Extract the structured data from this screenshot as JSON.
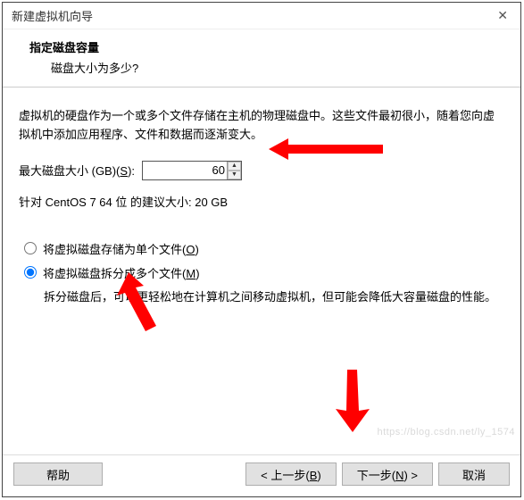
{
  "window": {
    "title": "新建虚拟机向导"
  },
  "header": {
    "title": "指定磁盘容量",
    "subtitle": "磁盘大小为多少?"
  },
  "body": {
    "description": "虚拟机的硬盘作为一个或多个文件存储在主机的物理磁盘中。这些文件最初很小，随着您向虚拟机中添加应用程序、文件和数据而逐渐变大。",
    "size_label_prefix": "最大磁盘大小 (GB)(",
    "size_label_hotkey": "S",
    "size_label_suffix": "):",
    "size_value": "60",
    "recommend": "针对 CentOS 7 64 位 的建议大小: 20 GB",
    "radio": {
      "single_prefix": "将虚拟磁盘存储为单个文件(",
      "single_hotkey": "O",
      "single_suffix": ")",
      "split_prefix": "将虚拟磁盘拆分成多个文件(",
      "split_hotkey": "M",
      "split_suffix": ")",
      "split_desc": "拆分磁盘后，可以更轻松地在计算机之间移动虚拟机，但可能会降低大容量磁盘的性能。"
    }
  },
  "buttons": {
    "help": "帮助",
    "back_prefix": "< 上一步(",
    "back_hotkey": "B",
    "back_suffix": ")",
    "next_prefix": "下一步(",
    "next_hotkey": "N",
    "next_suffix": ") >",
    "cancel": "取消"
  },
  "watermark": "https://blog.csdn.net/ly_1574",
  "annotation": {
    "arrow_color": "#ff0000"
  }
}
